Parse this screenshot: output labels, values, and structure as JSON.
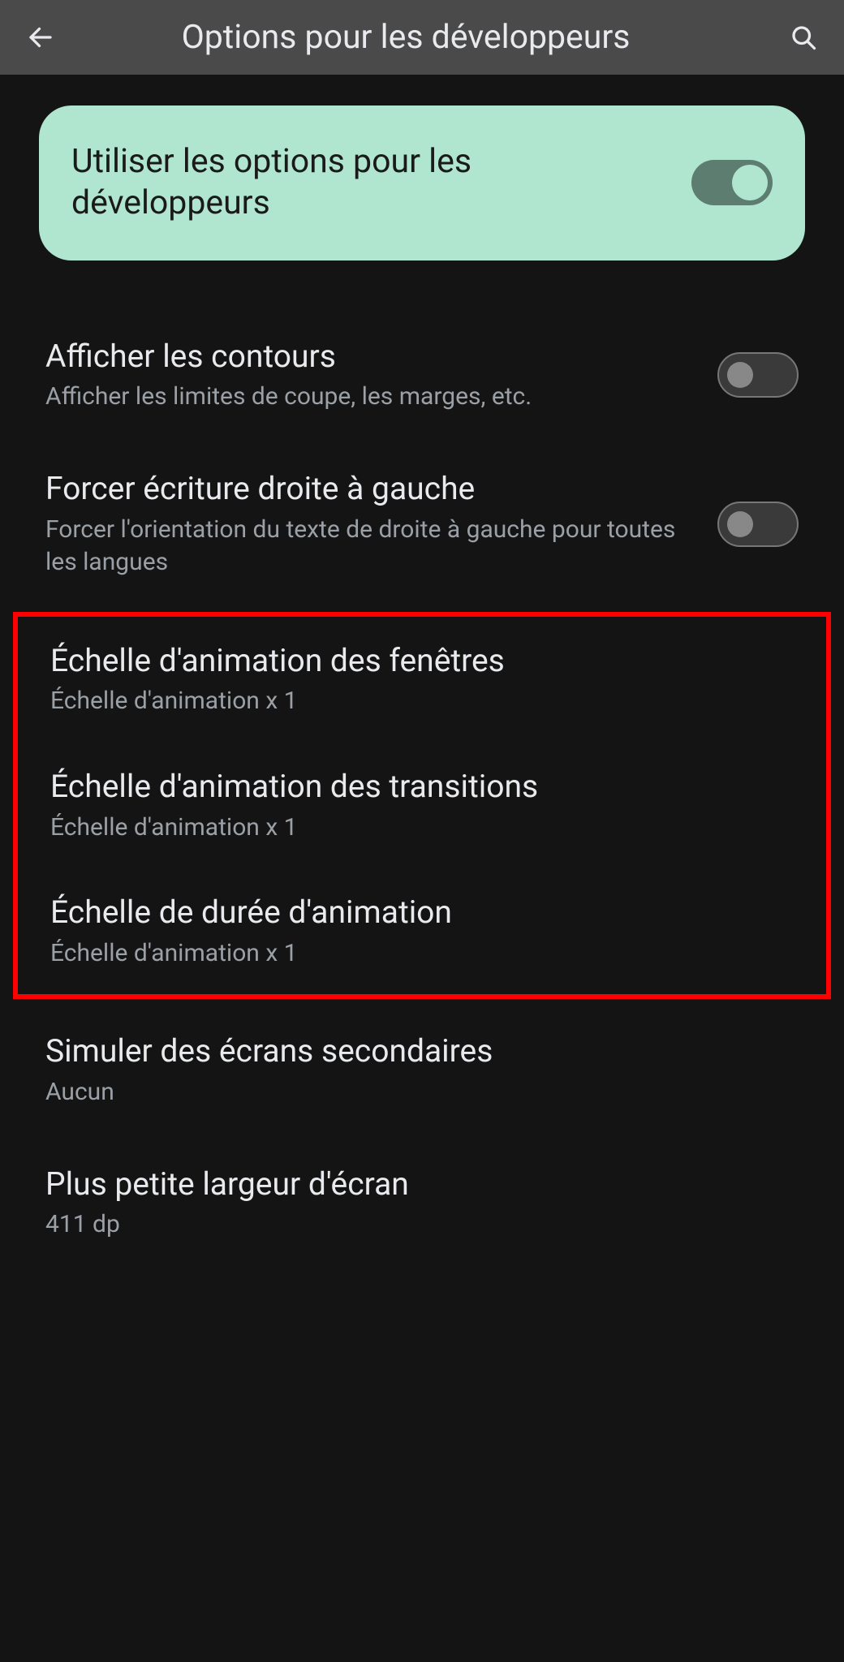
{
  "header": {
    "title": "Options pour les développeurs"
  },
  "master": {
    "label": "Utiliser les options pour les développeurs"
  },
  "items": {
    "contours": {
      "title": "Afficher les contours",
      "sub": "Afficher les limites de coupe, les marges, etc."
    },
    "rtl": {
      "title": "Forcer écriture droite à gauche",
      "sub": "Forcer l'orientation du texte de droite à gauche pour toutes les langues"
    },
    "anim_window": {
      "title": "Échelle d'animation des fenêtres",
      "sub": "Échelle d'animation x 1"
    },
    "anim_transition": {
      "title": "Échelle d'animation des transitions",
      "sub": "Échelle d'animation x 1"
    },
    "anim_duration": {
      "title": "Échelle de durée d'animation",
      "sub": "Échelle d'animation x 1"
    },
    "secondary": {
      "title": "Simuler des écrans secondaires",
      "sub": "Aucun"
    },
    "smallest_width": {
      "title": "Plus petite largeur d'écran",
      "sub": "411 dp"
    }
  }
}
